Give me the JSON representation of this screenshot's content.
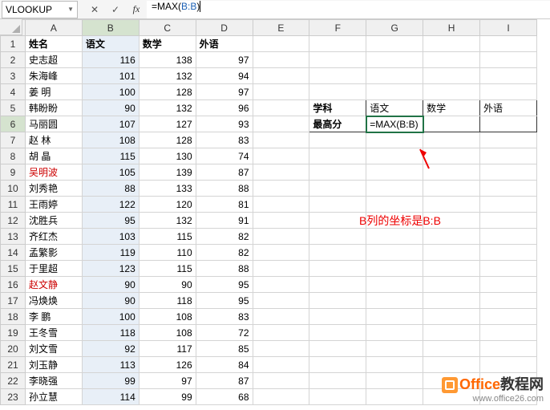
{
  "name_box": "VLOOKUP",
  "formula_prefix": "=MAX(",
  "formula_ref": "B:B",
  "formula_suffix": ")",
  "col_headers": [
    "A",
    "B",
    "C",
    "D",
    "E",
    "F",
    "G",
    "H",
    "I"
  ],
  "headers_row": {
    "A": "姓名",
    "B": "语文",
    "C": "数学",
    "D": "外语"
  },
  "rows": [
    {
      "name": "史志超",
      "b": 116,
      "c": 138,
      "d": 97
    },
    {
      "name": "朱海峰",
      "b": 101,
      "c": 132,
      "d": 94
    },
    {
      "name": "姜 明",
      "b": 100,
      "c": 128,
      "d": 97
    },
    {
      "name": "韩盼盼",
      "b": 90,
      "c": 132,
      "d": 96
    },
    {
      "name": "马丽圆",
      "b": 107,
      "c": 127,
      "d": 93
    },
    {
      "name": "赵 林",
      "b": 108,
      "c": 128,
      "d": 83
    },
    {
      "name": "胡 晶",
      "b": 115,
      "c": 130,
      "d": 74
    },
    {
      "name": "吴明波",
      "b": 105,
      "c": 139,
      "d": 87,
      "red": true
    },
    {
      "name": "刘秀艳",
      "b": 88,
      "c": 133,
      "d": 88
    },
    {
      "name": "王雨婷",
      "b": 122,
      "c": 120,
      "d": 81
    },
    {
      "name": "沈胜兵",
      "b": 95,
      "c": 132,
      "d": 91
    },
    {
      "name": "齐红杰",
      "b": 103,
      "c": 115,
      "d": 82
    },
    {
      "name": "孟繁影",
      "b": 119,
      "c": 110,
      "d": 82
    },
    {
      "name": "于里超",
      "b": 123,
      "c": 115,
      "d": 88
    },
    {
      "name": "赵文静",
      "b": 90,
      "c": 90,
      "d": 95,
      "red": true
    },
    {
      "name": "冯焕焕",
      "b": 90,
      "c": 118,
      "d": 95
    },
    {
      "name": "李 鹏",
      "b": 100,
      "c": 108,
      "d": 83
    },
    {
      "name": "王冬雪",
      "b": 118,
      "c": 108,
      "d": 72
    },
    {
      "name": "刘文雪",
      "b": 92,
      "c": 117,
      "d": 85
    },
    {
      "name": "刘玉静",
      "b": 113,
      "c": 126,
      "d": 84
    },
    {
      "name": "李晓强",
      "b": 99,
      "c": 97,
      "d": 87
    },
    {
      "name": "孙立慧",
      "b": 114,
      "c": 99,
      "d": 68
    }
  ],
  "side_table": {
    "row_label1": "学科",
    "row_label2": "最高分",
    "c1": "语文",
    "c2": "数学",
    "c3": "外语",
    "active_formula": "=MAX(B:B)"
  },
  "annotation": "B列的坐标是B:B",
  "watermark": {
    "brand1": "Office",
    "brand2": "教程网",
    "url": "www.office26.com"
  },
  "chart_data": {
    "type": "table",
    "columns": [
      "姓名",
      "语文",
      "数学",
      "外语"
    ],
    "data": [
      [
        "史志超",
        116,
        138,
        97
      ],
      [
        "朱海峰",
        101,
        132,
        94
      ],
      [
        "姜 明",
        100,
        128,
        97
      ],
      [
        "韩盼盼",
        90,
        132,
        96
      ],
      [
        "马丽圆",
        107,
        127,
        93
      ],
      [
        "赵 林",
        108,
        128,
        83
      ],
      [
        "胡 晶",
        115,
        130,
        74
      ],
      [
        "吴明波",
        105,
        139,
        87
      ],
      [
        "刘秀艳",
        88,
        133,
        88
      ],
      [
        "王雨婷",
        122,
        120,
        81
      ],
      [
        "沈胜兵",
        95,
        132,
        91
      ],
      [
        "齐红杰",
        103,
        115,
        82
      ],
      [
        "孟繁影",
        119,
        110,
        82
      ],
      [
        "于里超",
        123,
        115,
        88
      ],
      [
        "赵文静",
        90,
        90,
        95
      ],
      [
        "冯焕焕",
        90,
        118,
        95
      ],
      [
        "李 鹏",
        100,
        108,
        83
      ],
      [
        "王冬雪",
        118,
        108,
        72
      ],
      [
        "刘文雪",
        92,
        117,
        85
      ],
      [
        "刘玉静",
        113,
        126,
        84
      ],
      [
        "李晓强",
        99,
        97,
        87
      ],
      [
        "孙立慧",
        114,
        99,
        68
      ]
    ]
  }
}
